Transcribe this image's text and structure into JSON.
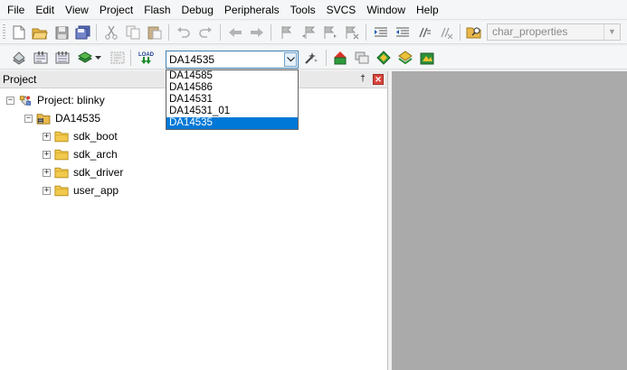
{
  "menubar": {
    "items": [
      "File",
      "Edit",
      "View",
      "Project",
      "Flash",
      "Debug",
      "Peripherals",
      "Tools",
      "SVCS",
      "Window",
      "Help"
    ]
  },
  "toolbar": {
    "file_combo_value": "char_properties",
    "load_label": "LOAD"
  },
  "target_select": {
    "value": "DA14535",
    "options": [
      "DA14585",
      "DA14586",
      "DA14531",
      "DA14531_01",
      "DA14535"
    ],
    "selected": "DA14535"
  },
  "project_panel": {
    "title": "Project",
    "pin_glyph": "†",
    "close_glyph": "✕",
    "tree": {
      "project": "Project: blinky",
      "target": "DA14535",
      "groups": [
        "sdk_boot",
        "sdk_arch",
        "sdk_driver",
        "user_app"
      ]
    }
  },
  "colors": {
    "selection": "#0078d7",
    "workspace": "#aaaaaa",
    "close_button": "#d9453c"
  }
}
